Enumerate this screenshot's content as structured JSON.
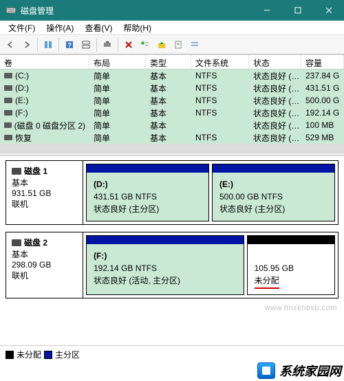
{
  "window": {
    "title": "磁盘管理"
  },
  "menu": {
    "file": "文件(F)",
    "action": "操作(A)",
    "view": "查看(V)",
    "help": "帮助(H)"
  },
  "columns": {
    "c0": "卷",
    "c1": "布局",
    "c2": "类型",
    "c3": "文件系统",
    "c4": "状态",
    "c5": "容量"
  },
  "volumes": [
    {
      "name": "(C:)",
      "layout": "简单",
      "type": "基本",
      "fs": "NTFS",
      "status": "状态良好 (…",
      "cap": "237.84 G"
    },
    {
      "name": "(D:)",
      "layout": "简单",
      "type": "基本",
      "fs": "NTFS",
      "status": "状态良好 (…",
      "cap": "431.51 G"
    },
    {
      "name": "(E:)",
      "layout": "简单",
      "type": "基本",
      "fs": "NTFS",
      "status": "状态良好 (…",
      "cap": "500.00 G"
    },
    {
      "name": "(F:)",
      "layout": "简单",
      "type": "基本",
      "fs": "NTFS",
      "status": "状态良好 (…",
      "cap": "192.14 G"
    },
    {
      "name": "(磁盘 0 磁盘分区 2)",
      "layout": "简单",
      "type": "基本",
      "fs": "",
      "status": "状态良好 (…",
      "cap": "100 MB"
    },
    {
      "name": "恢复",
      "layout": "简单",
      "type": "基本",
      "fs": "NTFS",
      "status": "状态良好 (…",
      "cap": "529 MB"
    }
  ],
  "disks": {
    "disk1": {
      "name": "磁盘 1",
      "type": "基本",
      "size": "931.51 GB",
      "status": "联机",
      "parts": [
        {
          "label": "(D:)",
          "size": "431.51 GB NTFS",
          "status": "状态良好 (主分区)",
          "kind": "primary"
        },
        {
          "label": "(E:)",
          "size": "500.00 GB NTFS",
          "status": "状态良好 (主分区)",
          "kind": "primary"
        }
      ]
    },
    "disk2": {
      "name": "磁盘 2",
      "type": "基本",
      "size": "298.09 GB",
      "status": "联机",
      "parts": [
        {
          "label": "(F:)",
          "size": "192.14 GB NTFS",
          "status": "状态良好 (活动, 主分区)",
          "kind": "primary"
        },
        {
          "label": "",
          "size": "105.95 GB",
          "status": "未分配",
          "kind": "unalloc"
        }
      ]
    }
  },
  "legend": {
    "unalloc": "未分配",
    "primary": "主分区"
  },
  "watermark": {
    "text": "系统家园网",
    "url": "www.hnzkhbsb.com"
  }
}
